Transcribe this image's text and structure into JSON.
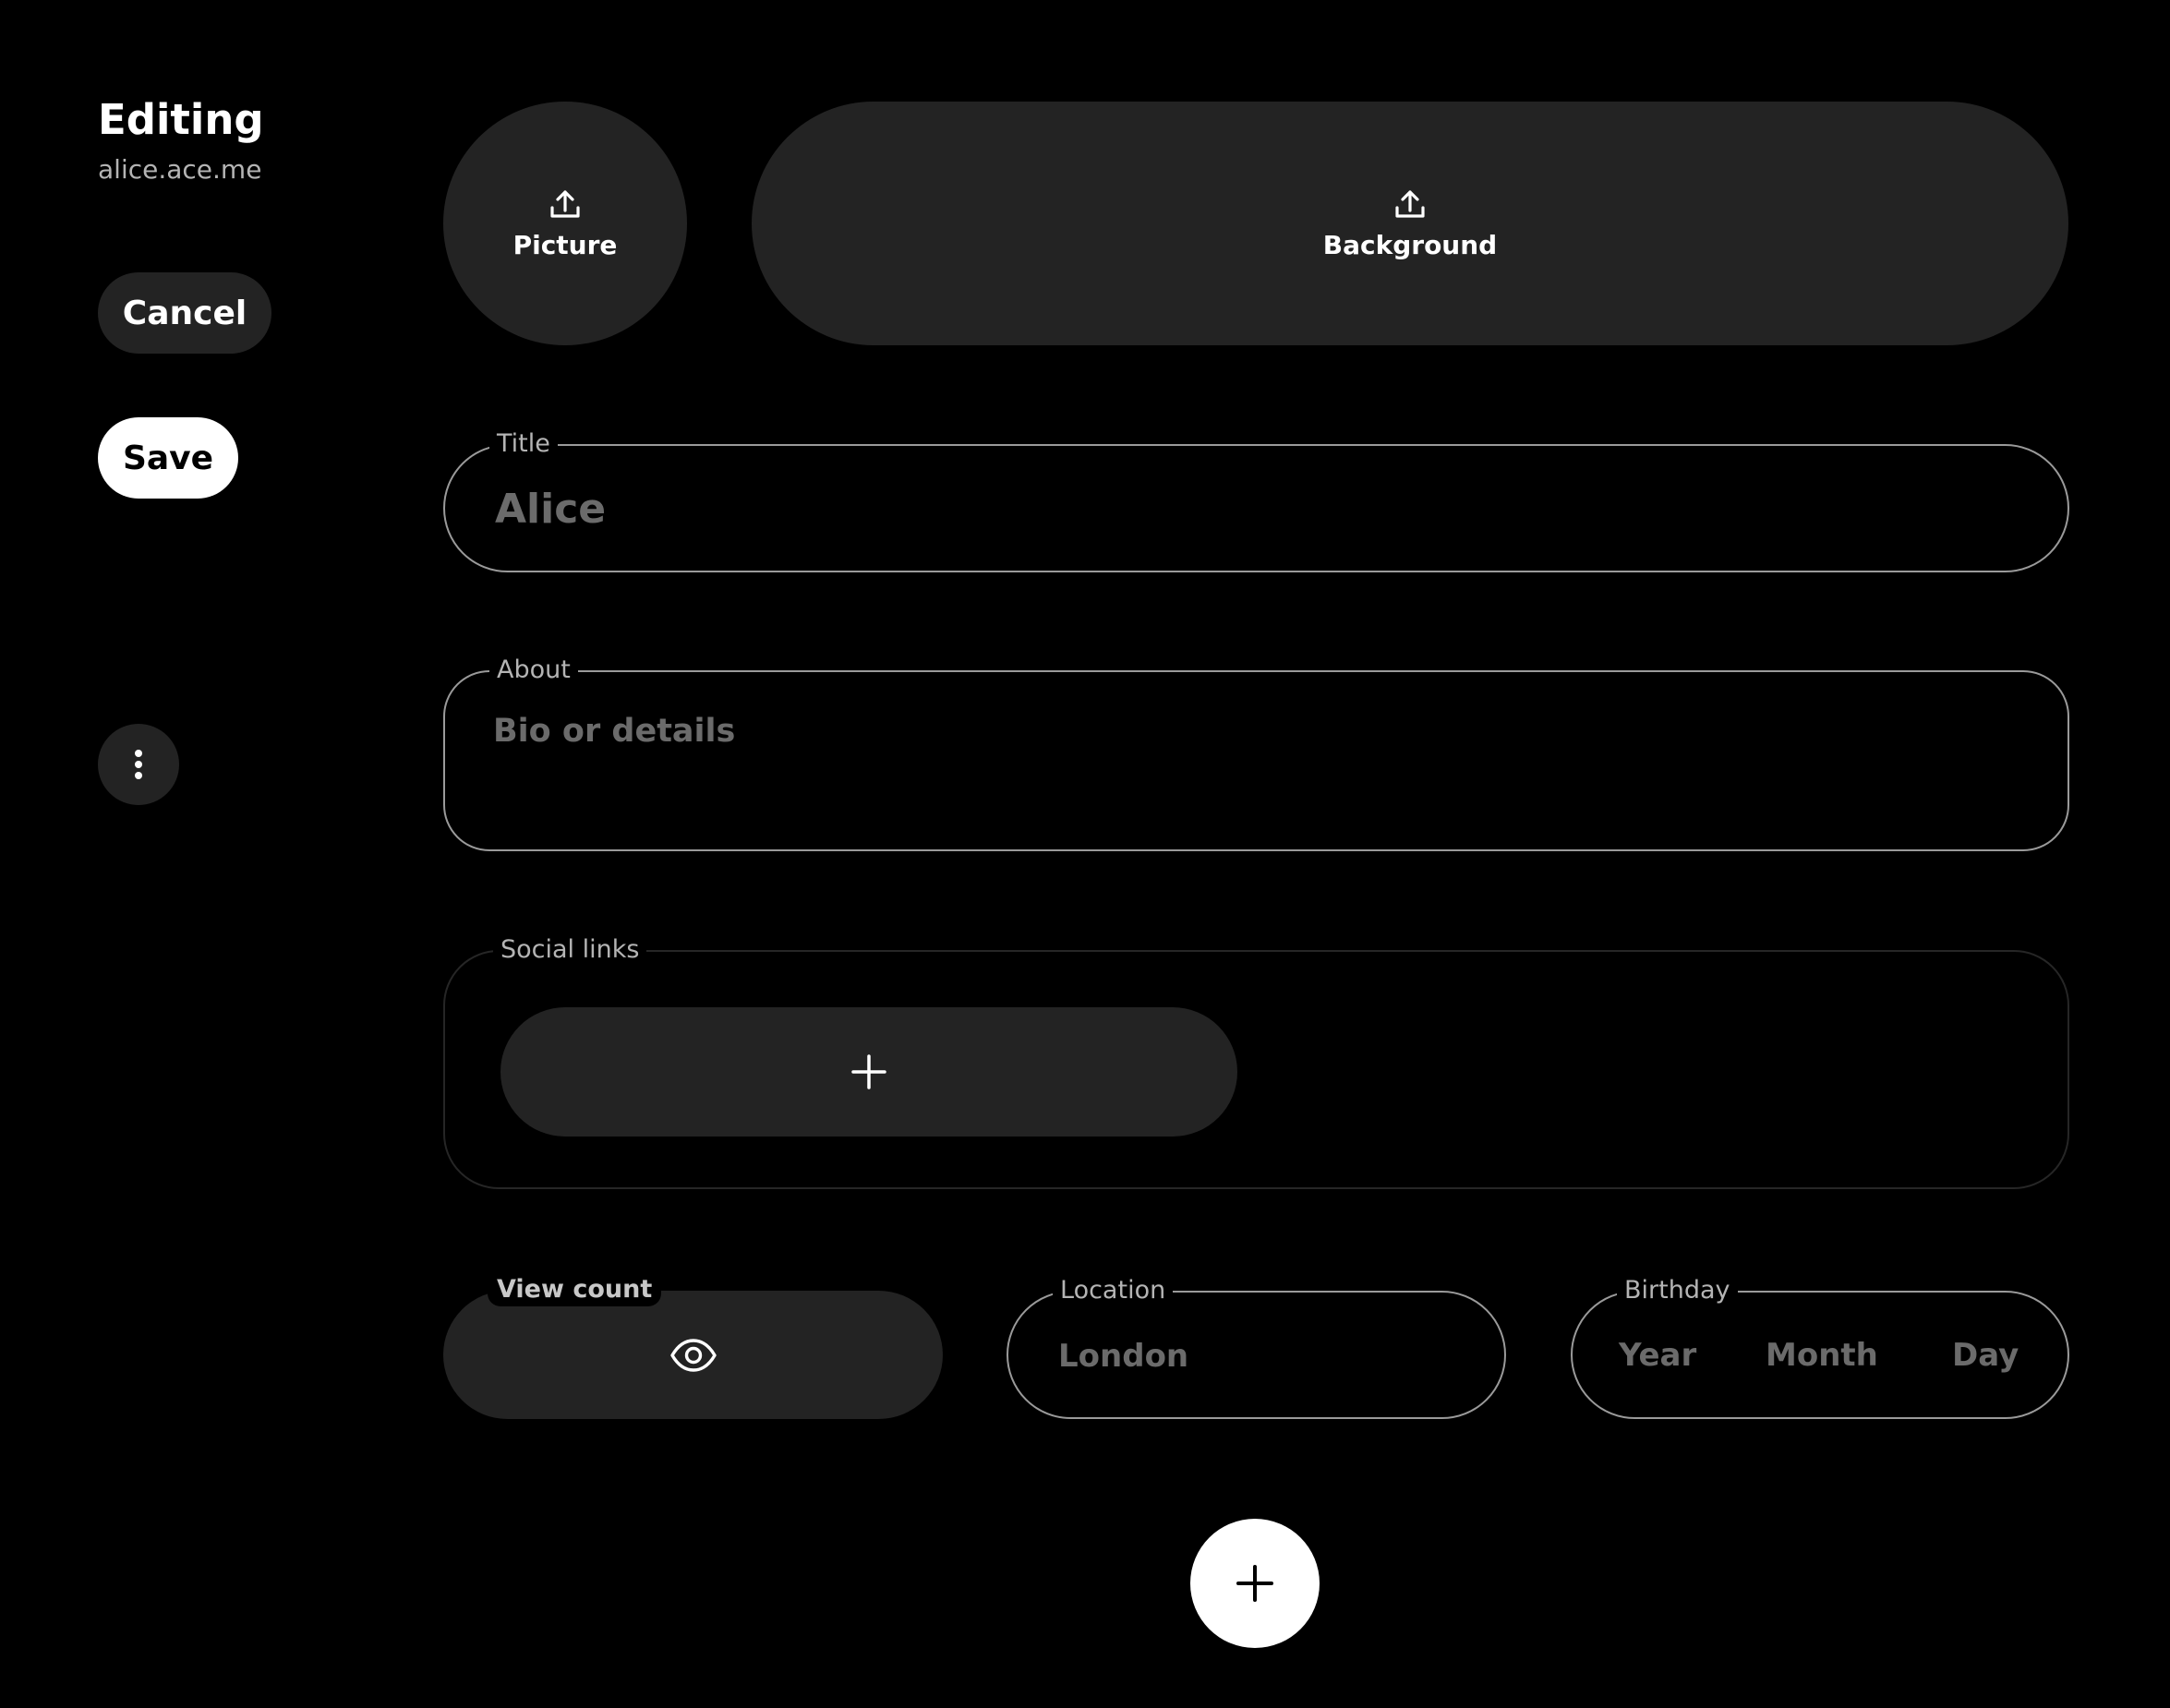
{
  "header": {
    "title": "Editing",
    "subtitle": "alice.ace.me"
  },
  "sidebar": {
    "cancel_label": "Cancel",
    "save_label": "Save",
    "more_icon": "more-vertical-icon"
  },
  "uploads": {
    "picture_label": "Picture",
    "background_label": "Background",
    "icon": "upload-icon"
  },
  "fields": {
    "title": {
      "label": "Title",
      "value": "",
      "placeholder": "Alice"
    },
    "about": {
      "label": "About",
      "value": "",
      "placeholder": "Bio or details"
    },
    "social_links": {
      "label": "Social links",
      "add_icon": "plus-icon"
    },
    "view_count": {
      "label": "View count",
      "icon": "eye-icon"
    },
    "location": {
      "label": "Location",
      "value": "",
      "placeholder": "London"
    },
    "birthday": {
      "label": "Birthday",
      "year_placeholder": "Year",
      "month_placeholder": "Month",
      "day_placeholder": "Day"
    }
  },
  "fab": {
    "icon": "plus-icon"
  },
  "colors": {
    "background": "#000000",
    "surface": "#232323",
    "outline": "#9a9a9a",
    "placeholder": "#6b6b6b",
    "label": "#b4b4b4",
    "primary_button": "#ffffff"
  }
}
